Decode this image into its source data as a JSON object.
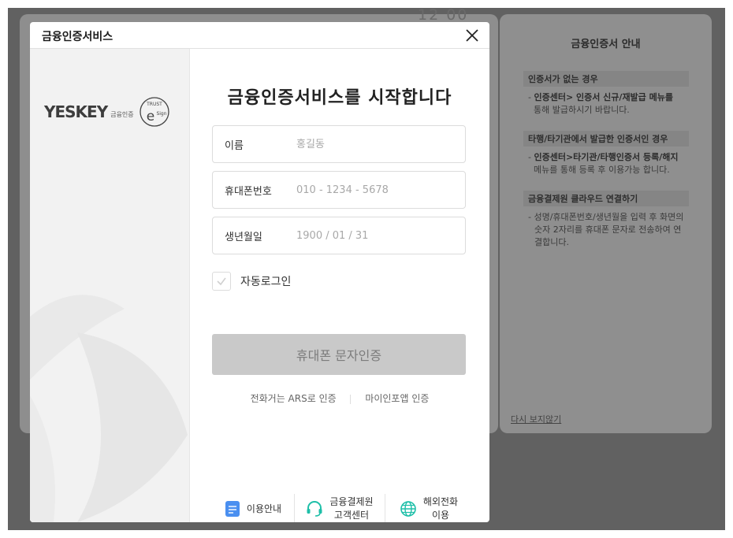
{
  "background": {
    "digits": "12 00"
  },
  "side_panel": {
    "title": "금융인증서 안내",
    "sections": [
      {
        "heading": "인증서가 없는 경우",
        "body_bold": "인증센터> 인증서 신규/재발급 메뉴를",
        "body": "통해 발급하시기 바랍니다."
      },
      {
        "heading": "타행/타기관에서 발급한 인증서인 경우",
        "body_bold": "인증센터>타기관/타행인증서 등록/해지",
        "body": "메뉴를 통해 등록 후 이용가능 합니다."
      },
      {
        "heading": "금융결제원 클라우드 연결하기",
        "body_bold": "",
        "body": "성명/휴대폰번호/생년월을 입력 후 화면의 숫자 2자리를 휴대폰 문자로 전송하여 연결합니다."
      }
    ],
    "dismiss_link": "다시 보지않기"
  },
  "dialog": {
    "title": "금융인증서비스",
    "logo_text": "YESKEY",
    "logo_sub": "금융인증",
    "badge_top": "TRUST",
    "badge_letter": "e",
    "badge_side": "Sign",
    "heading": "금융인증서비스를 시작합니다",
    "fields": [
      {
        "label": "이름",
        "placeholder": "홍길동"
      },
      {
        "label": "휴대폰번호",
        "placeholder": "010 - 1234 - 5678"
      },
      {
        "label": "생년월일",
        "placeholder": "1900 / 01 / 31"
      }
    ],
    "auto_login_label": "자동로그인",
    "submit_label": "휴대폰 문자인증",
    "alt_auth": [
      "전화거는 ARS로 인증",
      "마이인포앱 인증"
    ],
    "footer": [
      {
        "label": "이용안내",
        "icon": "document-icon",
        "color": "#4a8ff0"
      },
      {
        "label_line1": "금융결제원",
        "label_line2": "고객센터",
        "icon": "headset-icon",
        "color": "#1ebfa8"
      },
      {
        "label_line1": "해외전화",
        "label_line2": "이용",
        "icon": "globe-icon",
        "color": "#1ebfa8"
      }
    ]
  },
  "colors": {
    "overlay": "#616161",
    "submit_disabled": "#c9c9c9",
    "accent_teal": "#1ebfa8",
    "accent_blue": "#4a8ff0"
  }
}
